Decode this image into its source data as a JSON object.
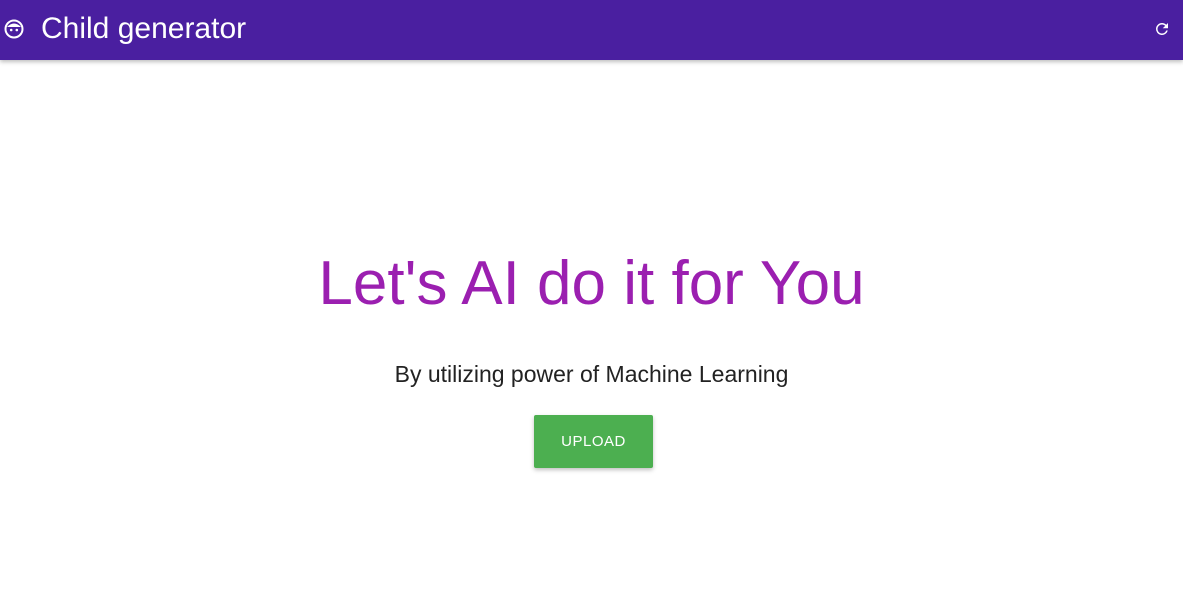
{
  "app_bar": {
    "title": "Child generator",
    "logo_icon": "baby-face-icon",
    "refresh_icon": "refresh-icon",
    "background_color": "#4a1fa0"
  },
  "hero": {
    "title": "Let's AI do it for You",
    "subtitle": "By utilizing power of Machine Learning",
    "title_color": "#9b1fb0"
  },
  "actions": {
    "upload_label": "UPLOAD",
    "upload_color": "#4caf50"
  }
}
